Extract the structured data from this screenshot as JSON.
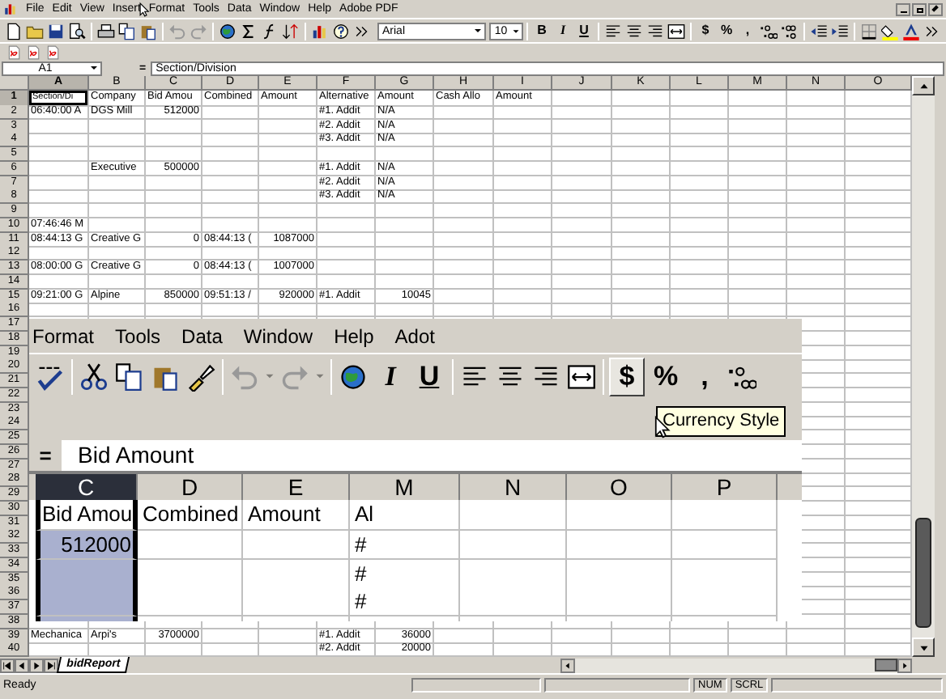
{
  "menu_bar": [
    "File",
    "Edit",
    "View",
    "Insert",
    "Format",
    "Tools",
    "Data",
    "Window",
    "Help",
    "Adobe PDF"
  ],
  "toolbar": {
    "font": "Arial",
    "size": "10",
    "buttons": [
      {
        "label": "B",
        "kind": "bold",
        "pressed": false
      },
      {
        "label": "I",
        "kind": "italic",
        "pressed": false
      },
      {
        "label": "U",
        "kind": "underline",
        "pressed": false
      },
      {
        "label": "$",
        "kind": "currency",
        "pressed": false
      },
      {
        "label": "%",
        "kind": "percent",
        "pressed": false
      },
      {
        "label": ",",
        "kind": "comma",
        "pressed": false
      }
    ]
  },
  "formula_bar": {
    "name_box": "A1",
    "equals": "=",
    "formula": "Section/Division"
  },
  "columns": [
    {
      "label": "A",
      "selected": true
    },
    {
      "label": "B",
      "selected": false
    },
    {
      "label": "C",
      "selected": false
    },
    {
      "label": "D",
      "selected": false
    },
    {
      "label": "E",
      "selected": false
    },
    {
      "label": "F",
      "selected": false
    },
    {
      "label": "G",
      "selected": false
    },
    {
      "label": "H",
      "selected": false
    },
    {
      "label": "I",
      "selected": false
    },
    {
      "label": "J",
      "selected": false
    },
    {
      "label": "K",
      "selected": false
    },
    {
      "label": "L",
      "selected": false
    },
    {
      "label": "M",
      "selected": false
    },
    {
      "label": "N",
      "selected": false
    },
    {
      "label": "O",
      "selected": false
    }
  ],
  "rows": [
    {
      "number": "1",
      "selected": true,
      "cells": {
        "A": "Section/Di",
        "B": "Company",
        "C": "Bid Amou",
        "D": "Combined",
        "E": "Amount",
        "F": "Alternative",
        "G": "Amount",
        "H": "Cash Allo",
        "I": "Amount"
      }
    },
    {
      "number": "2",
      "selected": false,
      "cells": {
        "A": "06:40:00 A",
        "B": "DGS Mill",
        "C": "512000",
        "F": "#1. Addit",
        "G": "N/A"
      }
    },
    {
      "number": "3",
      "selected": false,
      "cells": {
        "F": "#2. Addit",
        "G": "N/A"
      }
    },
    {
      "number": "4",
      "selected": false,
      "cells": {
        "F": "#3. Addit",
        "G": "N/A"
      }
    },
    {
      "number": "5",
      "selected": false,
      "cells": {}
    },
    {
      "number": "6",
      "selected": false,
      "cells": {
        "B": "Executive",
        "C": "500000",
        "F": "#1. Addit",
        "G": "N/A"
      }
    },
    {
      "number": "7",
      "selected": false,
      "cells": {
        "F": "#2. Addit",
        "G": "N/A"
      }
    },
    {
      "number": "8",
      "selected": false,
      "cells": {
        "F": "#3. Addit",
        "G": "N/A"
      }
    },
    {
      "number": "9",
      "selected": false,
      "cells": {}
    },
    {
      "number": "10",
      "selected": false,
      "cells": {
        "A": "07:46:46 M"
      }
    },
    {
      "number": "11",
      "selected": false,
      "cells": {
        "A": "08:44:13 G",
        "B": "Creative G",
        "C": "0",
        "D": "08:44:13 (",
        "E": "1087000"
      }
    },
    {
      "number": "12",
      "selected": false,
      "cells": {}
    },
    {
      "number": "13",
      "selected": false,
      "cells": {
        "A": "08:00:00 G",
        "B": "Creative G",
        "C": "0",
        "D": "08:44:13 (",
        "E": "1007000"
      }
    },
    {
      "number": "14",
      "selected": false,
      "cells": {}
    },
    {
      "number": "15",
      "selected": false,
      "cells": {
        "A": "09:21:00 G",
        "B": "Alpine",
        "C": "850000",
        "D": "09:51:13 /",
        "E": "920000",
        "F": "#1. Addit",
        "G": "10045"
      }
    },
    {
      "number": "16",
      "selected": false,
      "cells": {}
    },
    {
      "number": "17",
      "selected": false,
      "cells": {}
    },
    {
      "number": "18",
      "selected": false,
      "cells": {}
    },
    {
      "number": "19",
      "selected": false,
      "cells": {}
    },
    {
      "number": "20",
      "selected": false,
      "cells": {}
    },
    {
      "number": "21",
      "selected": false,
      "cells": {}
    },
    {
      "number": "22",
      "selected": false,
      "cells": {}
    },
    {
      "number": "23",
      "selected": false,
      "cells": {}
    },
    {
      "number": "24",
      "selected": false,
      "cells": {}
    },
    {
      "number": "25",
      "selected": false,
      "cells": {}
    },
    {
      "number": "26",
      "selected": false,
      "cells": {}
    },
    {
      "number": "27",
      "selected": false,
      "cells": {}
    },
    {
      "number": "28",
      "selected": false,
      "cells": {}
    },
    {
      "number": "29",
      "selected": false,
      "cells": {}
    },
    {
      "number": "30",
      "selected": false,
      "cells": {}
    },
    {
      "number": "31",
      "selected": false,
      "cells": {}
    },
    {
      "number": "32",
      "selected": false,
      "cells": {}
    },
    {
      "number": "33",
      "selected": false,
      "cells": {}
    },
    {
      "number": "34",
      "selected": false,
      "cells": {}
    },
    {
      "number": "35",
      "selected": false,
      "cells": {}
    },
    {
      "number": "36",
      "selected": false,
      "cells": {}
    },
    {
      "number": "37",
      "selected": false,
      "cells": {}
    },
    {
      "number": "38",
      "selected": false,
      "cells": {}
    },
    {
      "number": "39",
      "selected": false,
      "cells": {
        "A": "Mechanica",
        "B": "Arpi's",
        "C": "3700000",
        "F": "#1. Addit",
        "G": "36000"
      }
    },
    {
      "number": "40",
      "selected": false,
      "cells": {
        "F": "#2. Addit",
        "G": "20000"
      }
    }
  ],
  "sheet_tabs": [
    {
      "label": "bidReport",
      "selected": true
    }
  ],
  "status_bar": {
    "text": "Ready",
    "indicators": [
      "NUM",
      "SCRL"
    ]
  },
  "zoom_inset": {
    "menu": [
      "Format",
      "Tools",
      "Data",
      "Window",
      "Help",
      "Adot"
    ],
    "toolbar": [
      {
        "label": "I",
        "kind": "italic",
        "pressed": false
      },
      {
        "label": "U",
        "kind": "underline",
        "pressed": false
      },
      {
        "label": "$",
        "kind": "currency",
        "pressed": true
      },
      {
        "label": "%",
        "kind": "percent",
        "pressed": false
      },
      {
        "label": ",",
        "kind": "comma",
        "pressed": false
      }
    ],
    "tooltip": "Currency Style",
    "formula_bar": {
      "equals": "=",
      "formula": "Bid Amount"
    },
    "columns": [
      {
        "label": "C",
        "selected": true
      },
      {
        "label": "D",
        "selected": false
      },
      {
        "label": "E",
        "selected": false
      },
      {
        "label": "M",
        "selected": false
      },
      {
        "label": "N",
        "selected": false
      },
      {
        "label": "O",
        "selected": false
      },
      {
        "label": "P",
        "selected": false
      }
    ],
    "rows": [
      {
        "selected": true,
        "cells": {
          "C": "Bid Amou",
          "D": "Combined",
          "E": "Amount",
          "M": "Al"
        }
      },
      {
        "selected": false,
        "cells": {
          "C": "512000",
          "M": "#"
        }
      },
      {
        "selected": false,
        "cells": {
          "M": "#"
        }
      },
      {
        "selected": false,
        "cells": {
          "M": "#"
        }
      },
      {
        "selected": false,
        "cells": {}
      }
    ]
  }
}
